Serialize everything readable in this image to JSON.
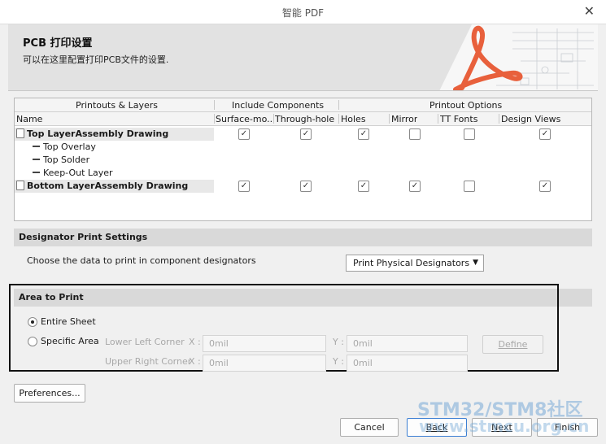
{
  "window": {
    "title": "智能 PDF",
    "close_glyph": "✕"
  },
  "banner": {
    "title": "PCB 打印设置",
    "subtitle": "可以在这里配置打印PCB文件的设置.",
    "accent": "#e8603c"
  },
  "table": {
    "groups": [
      "Printouts & Layers",
      "Include Components",
      "Printout Options"
    ],
    "columns": [
      "Name",
      "Surface-mo...",
      "Through-hole",
      "Holes",
      "Mirror",
      "TT Fonts",
      "Design Views"
    ],
    "rows": [
      {
        "label": "Top LayerAssembly Drawing",
        "parent": true,
        "checks": [
          true,
          true,
          true,
          false,
          false,
          true
        ]
      },
      {
        "label": "Top Overlay",
        "parent": false
      },
      {
        "label": "Top Solder",
        "parent": false
      },
      {
        "label": "Keep-Out Layer",
        "parent": false
      },
      {
        "label": "Bottom LayerAssembly Drawing",
        "parent": true,
        "checks": [
          true,
          true,
          true,
          true,
          false,
          true
        ]
      }
    ]
  },
  "designator": {
    "section_title": "Designator Print Settings",
    "prompt": "Choose the data to print in component designators",
    "selected": "Print Physical Designators"
  },
  "area": {
    "section_title": "Area to Print",
    "option_entire": "Entire Sheet",
    "option_specific": "Specific Area",
    "lower_left_label": "Lower Left Corner",
    "upper_right_label": "Upper Right Corner",
    "x_label": "X :",
    "y_label": "Y :",
    "ll_x": "0mil",
    "ll_y": "0mil",
    "ur_x": "0mil",
    "ur_y": "0mil",
    "define_label": "Define"
  },
  "buttons": {
    "preferences": "Preferences...",
    "cancel": "Cancel",
    "back": "Back",
    "next": "Next",
    "finish": "Finish"
  },
  "watermark": {
    "line1": "STM32/STM8社区",
    "line2": "www.stmcu.org.cn"
  }
}
